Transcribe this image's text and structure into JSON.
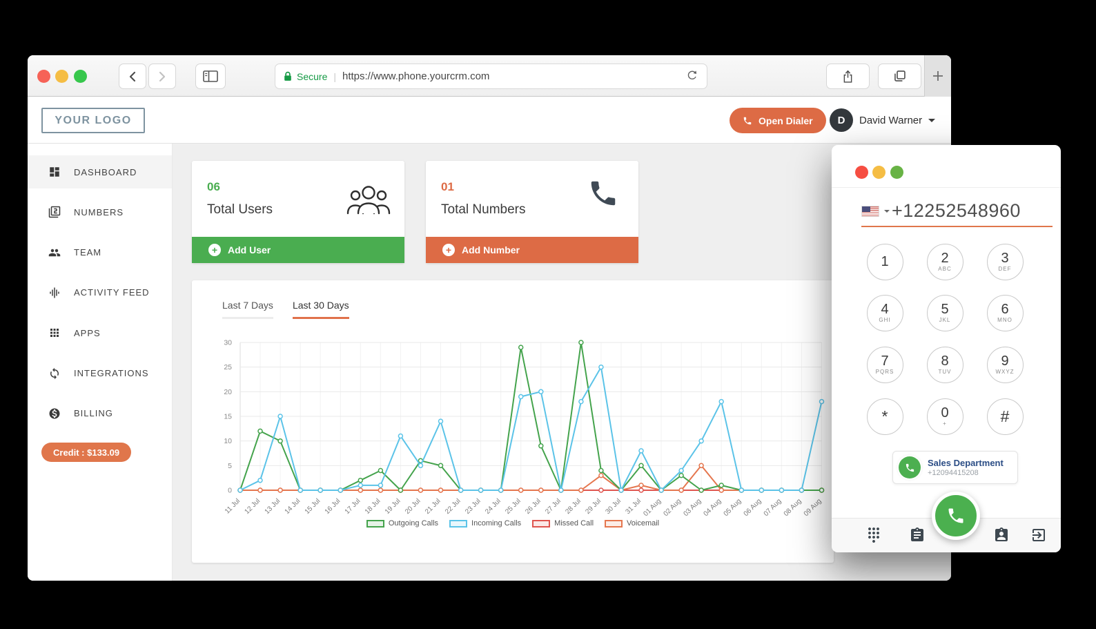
{
  "browser": {
    "secure_label": "Secure",
    "url": "https://www.phone.yourcrm.com"
  },
  "header": {
    "logo": "YOUR LOGO",
    "open_dialer_label": "Open Dialer",
    "user_initial": "D",
    "user_name": "David Warner"
  },
  "sidebar": {
    "items": [
      {
        "label": "DASHBOARD",
        "icon": "dashboard-icon",
        "active": true
      },
      {
        "label": "NUMBERS",
        "icon": "numbers-icon",
        "active": false
      },
      {
        "label": "TEAM",
        "icon": "team-icon",
        "active": false
      },
      {
        "label": "ACTIVITY FEED",
        "icon": "activity-icon",
        "active": false
      },
      {
        "label": "APPS",
        "icon": "apps-icon",
        "active": false
      },
      {
        "label": "INTEGRATIONS",
        "icon": "integrations-icon",
        "active": false
      },
      {
        "label": "BILLING",
        "icon": "billing-icon",
        "active": false
      }
    ],
    "credit_label": "Credit : $133.09"
  },
  "cards": [
    {
      "count": "06",
      "label": "Total Users",
      "action": "Add User",
      "accent": "#4aad50",
      "icon": "users-group-icon"
    },
    {
      "count": "01",
      "label": "Total Numbers",
      "action": "Add Number",
      "accent": "#dd6b45",
      "icon": "phone-icon"
    }
  ],
  "chart_tabs": [
    {
      "label": "Last 7 Days",
      "active": false
    },
    {
      "label": "Last 30 Days",
      "active": true
    }
  ],
  "chart_data": {
    "type": "line",
    "x": [
      "11 Jul",
      "12 Jul",
      "13 Jul",
      "14 Jul",
      "15 Jul",
      "16 Jul",
      "17 Jul",
      "18 Jul",
      "19 Jul",
      "20 Jul",
      "21 Jul",
      "22 Jul",
      "23 Jul",
      "24 Jul",
      "25 Jul",
      "26 Jul",
      "27 Jul",
      "28 Jul",
      "29 Jul",
      "30 Jul",
      "31 Jul",
      "01 Aug",
      "02 Aug",
      "03 Aug",
      "04 Aug",
      "05 Aug",
      "06 Aug",
      "07 Aug",
      "08 Aug",
      "09 Aug"
    ],
    "series": [
      {
        "name": "Outgoing Calls",
        "color": "#44a34c",
        "values": [
          0,
          12,
          10,
          0,
          0,
          0,
          2,
          4,
          0,
          6,
          5,
          0,
          0,
          0,
          29,
          9,
          0,
          30,
          4,
          0,
          5,
          0,
          3,
          0,
          1,
          0,
          0,
          0,
          0,
          0
        ]
      },
      {
        "name": "Incoming Calls",
        "color": "#5bc3e8",
        "values": [
          0,
          2,
          15,
          0,
          0,
          0,
          1,
          1,
          11,
          5,
          14,
          0,
          0,
          0,
          19,
          20,
          0,
          18,
          25,
          0,
          8,
          0,
          4,
          10,
          18,
          0,
          0,
          0,
          0,
          18
        ]
      },
      {
        "name": "Missed Call",
        "color": "#df544e",
        "values": [
          0,
          0,
          0,
          0,
          0,
          0,
          0,
          0,
          0,
          0,
          0,
          0,
          0,
          0,
          0,
          0,
          0,
          0,
          0,
          0,
          0,
          0,
          0,
          0,
          0,
          0,
          0,
          0,
          0,
          0
        ]
      },
      {
        "name": "Voicemail",
        "color": "#e5764e",
        "values": [
          0,
          0,
          0,
          0,
          0,
          0,
          0,
          0,
          0,
          0,
          0,
          0,
          0,
          0,
          0,
          0,
          0,
          0,
          3,
          0,
          1,
          0,
          0,
          5,
          0,
          0,
          0,
          0,
          0,
          0
        ]
      }
    ],
    "draw_order": [
      2,
      3,
      0,
      1
    ],
    "ylim": [
      0,
      30
    ],
    "yticks": [
      0,
      5,
      10,
      15,
      20,
      25,
      30
    ],
    "grid": true,
    "legend_position": "bottom"
  },
  "dialer": {
    "number": "+12252548960",
    "keys": [
      {
        "d": "1",
        "s": ""
      },
      {
        "d": "2",
        "s": "ABC"
      },
      {
        "d": "3",
        "s": "DEF"
      },
      {
        "d": "4",
        "s": "GHI"
      },
      {
        "d": "5",
        "s": "JKL"
      },
      {
        "d": "6",
        "s": "MNO"
      },
      {
        "d": "7",
        "s": "PQRS"
      },
      {
        "d": "8",
        "s": "TUV"
      },
      {
        "d": "9",
        "s": "WXYZ"
      },
      {
        "d": "*",
        "s": ""
      },
      {
        "d": "0",
        "s": "+"
      },
      {
        "d": "#",
        "s": ""
      }
    ],
    "contact": {
      "name": "Sales Department",
      "number": "+12094415208"
    }
  },
  "colors": {
    "accent_orange": "#dd6b45",
    "accent_green": "#4aad50",
    "secure_green": "#169a45",
    "contact_navy": "#2b4d85"
  }
}
